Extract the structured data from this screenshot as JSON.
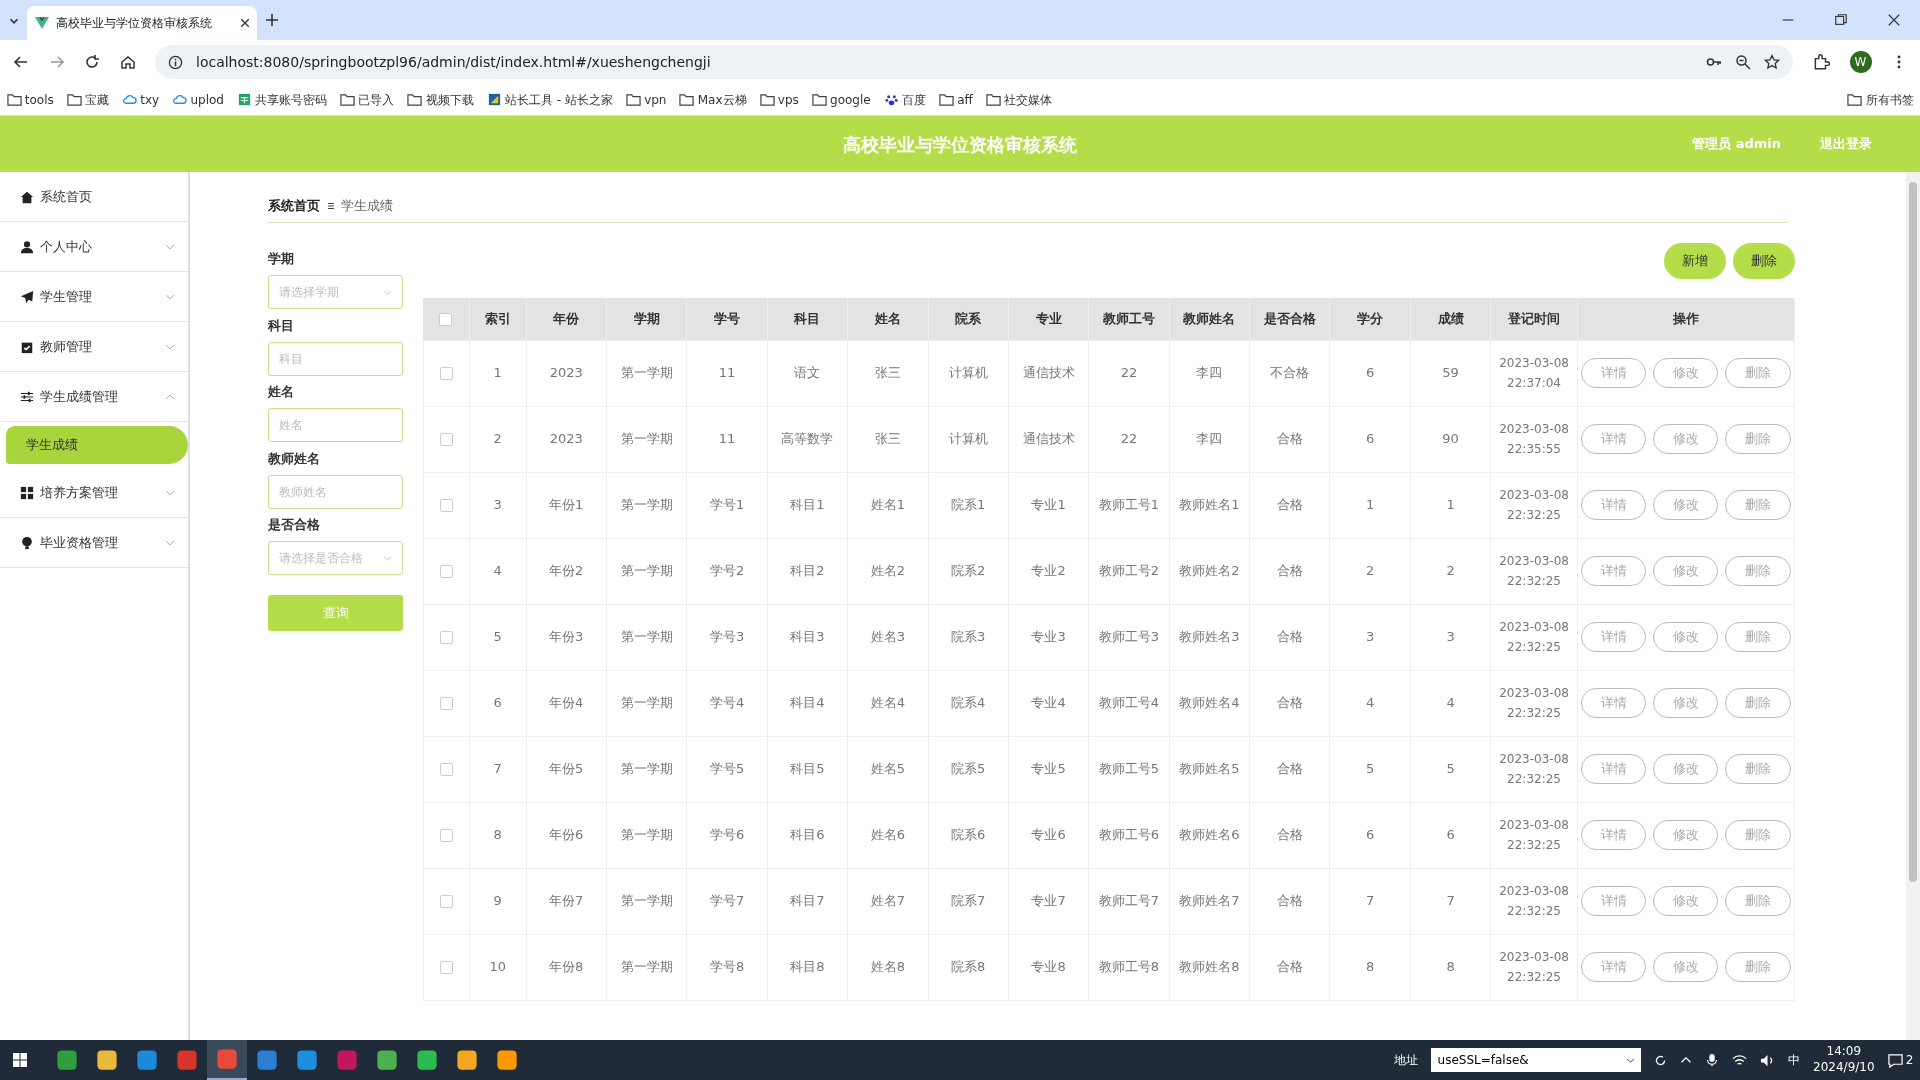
{
  "browser": {
    "tab_title": "高校毕业与学位资格审核系统",
    "url": "localhost:8080/springbootzpl96/admin/dist/index.html#/xueshengchengji",
    "profile": "W",
    "bookmarks": [
      {
        "label": "tools",
        "kind": "folder"
      },
      {
        "label": "宝藏",
        "kind": "folder"
      },
      {
        "label": "txy",
        "kind": "cloud"
      },
      {
        "label": "uplod",
        "kind": "cloud"
      },
      {
        "label": "共享账号密码",
        "kind": "sheet"
      },
      {
        "label": "已导入",
        "kind": "folder"
      },
      {
        "label": "视频下载",
        "kind": "folder"
      },
      {
        "label": "站长工具 - 站长之家",
        "kind": "site"
      },
      {
        "label": "vpn",
        "kind": "folder"
      },
      {
        "label": "Max云梯",
        "kind": "folder"
      },
      {
        "label": "vps",
        "kind": "folder"
      },
      {
        "label": "google",
        "kind": "folder"
      },
      {
        "label": "百度",
        "kind": "paw"
      },
      {
        "label": "aff",
        "kind": "folder"
      },
      {
        "label": "社交媒体",
        "kind": "folder"
      }
    ],
    "all_bookmarks": "所有书签"
  },
  "header": {
    "title": "高校毕业与学位资格审核系统",
    "user": "管理员 admin",
    "logout": "退出登录"
  },
  "sidebar": [
    {
      "label": "系统首页",
      "kind": "link"
    },
    {
      "label": "个人中心",
      "kind": "group",
      "expanded": false
    },
    {
      "label": "学生管理",
      "kind": "group",
      "expanded": false
    },
    {
      "label": "教师管理",
      "kind": "group",
      "expanded": false
    },
    {
      "label": "学生成绩管理",
      "kind": "group",
      "expanded": true,
      "children": [
        {
          "label": "学生成绩",
          "selected": true
        }
      ]
    },
    {
      "label": "培养方案管理",
      "kind": "group",
      "expanded": false
    },
    {
      "label": "毕业资格管理",
      "kind": "group",
      "expanded": false
    }
  ],
  "breadcrumb": [
    "系统首页",
    "学生成绩"
  ],
  "filters": [
    {
      "label": "学期",
      "kind": "select",
      "placeholder": "请选择学期"
    },
    {
      "label": "科目",
      "kind": "input",
      "placeholder": "科目"
    },
    {
      "label": "姓名",
      "kind": "input",
      "placeholder": "姓名"
    },
    {
      "label": "教师姓名",
      "kind": "input",
      "placeholder": "教师姓名"
    },
    {
      "label": "是否合格",
      "kind": "select",
      "placeholder": "请选择是否合格"
    }
  ],
  "query_button": "查询",
  "actions": [
    "新增",
    "删除"
  ],
  "table": {
    "select_all_checked": false,
    "columns": [
      "索引",
      "年份",
      "学期",
      "学号",
      "科目",
      "姓名",
      "院系",
      "专业",
      "教师工号",
      "教师姓名",
      "是否合格",
      "学分",
      "成绩",
      "登记时间",
      "操作"
    ],
    "rows": [
      {
        "checked": false,
        "cells": [
          "1",
          "2023",
          "第一学期",
          "11",
          "语文",
          "张三",
          "计算机",
          "通信技术",
          "22",
          "李四",
          "不合格",
          "6",
          "59",
          "2023-03-08 22:37:04"
        ],
        "actions": [
          "详情",
          "修改",
          "删除"
        ]
      },
      {
        "checked": false,
        "cells": [
          "2",
          "2023",
          "第一学期",
          "11",
          "高等数学",
          "张三",
          "计算机",
          "通信技术",
          "22",
          "李四",
          "合格",
          "6",
          "90",
          "2023-03-08 22:35:55"
        ],
        "actions": [
          "详情",
          "修改",
          "删除"
        ]
      },
      {
        "checked": false,
        "cells": [
          "3",
          "年份1",
          "第一学期",
          "学号1",
          "科目1",
          "姓名1",
          "院系1",
          "专业1",
          "教师工号1",
          "教师姓名1",
          "合格",
          "1",
          "1",
          "2023-03-08 22:32:25"
        ],
        "actions": [
          "详情",
          "修改",
          "删除"
        ]
      },
      {
        "checked": false,
        "cells": [
          "4",
          "年份2",
          "第一学期",
          "学号2",
          "科目2",
          "姓名2",
          "院系2",
          "专业2",
          "教师工号2",
          "教师姓名2",
          "合格",
          "2",
          "2",
          "2023-03-08 22:32:25"
        ],
        "actions": [
          "详情",
          "修改",
          "删除"
        ]
      },
      {
        "checked": false,
        "cells": [
          "5",
          "年份3",
          "第一学期",
          "学号3",
          "科目3",
          "姓名3",
          "院系3",
          "专业3",
          "教师工号3",
          "教师姓名3",
          "合格",
          "3",
          "3",
          "2023-03-08 22:32:25"
        ],
        "actions": [
          "详情",
          "修改",
          "删除"
        ]
      },
      {
        "checked": false,
        "cells": [
          "6",
          "年份4",
          "第一学期",
          "学号4",
          "科目4",
          "姓名4",
          "院系4",
          "专业4",
          "教师工号4",
          "教师姓名4",
          "合格",
          "4",
          "4",
          "2023-03-08 22:32:25"
        ],
        "actions": [
          "详情",
          "修改",
          "删除"
        ]
      },
      {
        "checked": false,
        "cells": [
          "7",
          "年份5",
          "第一学期",
          "学号5",
          "科目5",
          "姓名5",
          "院系5",
          "专业5",
          "教师工号5",
          "教师姓名5",
          "合格",
          "5",
          "5",
          "2023-03-08 22:32:25"
        ],
        "actions": [
          "详情",
          "修改",
          "删除"
        ]
      },
      {
        "checked": false,
        "cells": [
          "8",
          "年份6",
          "第一学期",
          "学号6",
          "科目6",
          "姓名6",
          "院系6",
          "专业6",
          "教师工号6",
          "教师姓名6",
          "合格",
          "6",
          "6",
          "2023-03-08 22:32:25"
        ],
        "actions": [
          "详情",
          "修改",
          "删除"
        ]
      },
      {
        "checked": false,
        "cells": [
          "9",
          "年份7",
          "第一学期",
          "学号7",
          "科目7",
          "姓名7",
          "院系7",
          "专业7",
          "教师工号7",
          "教师姓名7",
          "合格",
          "7",
          "7",
          "2023-03-08 22:32:25"
        ],
        "actions": [
          "详情",
          "修改",
          "删除"
        ]
      },
      {
        "checked": false,
        "cells": [
          "10",
          "年份8",
          "第一学期",
          "学号8",
          "科目8",
          "姓名8",
          "院系8",
          "专业8",
          "教师工号8",
          "教师姓名8",
          "合格",
          "8",
          "8",
          "2023-03-08 22:32:25"
        ],
        "actions": [
          "详情",
          "修改",
          "删除"
        ]
      }
    ]
  },
  "taskbar": {
    "address_label": "地址",
    "address_value": "useSSL=false&",
    "ime": "中",
    "time": "14:09",
    "date": "2024/9/10",
    "notifications": "2",
    "apps": [
      {
        "color": "#2e9e3e",
        "selected": false
      },
      {
        "color": "#e8b93a",
        "selected": false
      },
      {
        "color": "#1b8ad8",
        "selected": false
      },
      {
        "color": "#d9342b",
        "selected": false
      },
      {
        "color": "#e84a3a",
        "selected": true
      },
      {
        "color": "#2a7fd4",
        "selected": false
      },
      {
        "color": "#1d8fe0",
        "selected": false
      },
      {
        "color": "#c2185b",
        "selected": false
      },
      {
        "color": "#4caf50",
        "selected": false
      },
      {
        "color": "#2dbb4e",
        "selected": false
      },
      {
        "color": "#f5a623",
        "selected": false
      },
      {
        "color": "#ff9800",
        "selected": false
      }
    ]
  }
}
